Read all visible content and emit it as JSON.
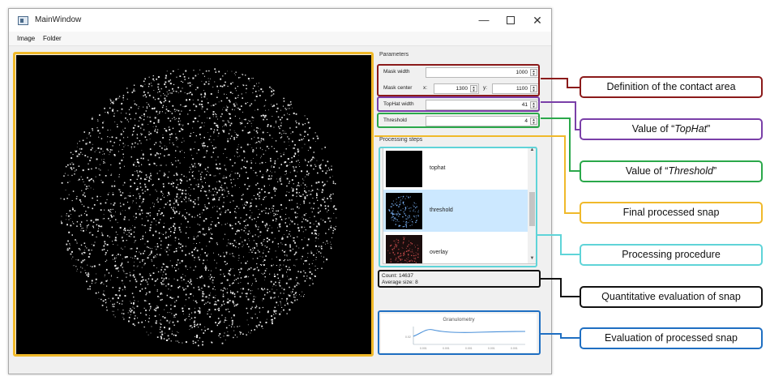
{
  "window": {
    "title": "MainWindow",
    "min": "—",
    "close": "✕"
  },
  "menu": {
    "image": "Image",
    "folder": "Folder"
  },
  "parameters": {
    "group_title": "Parameters",
    "mask_width_label": "Mask width",
    "mask_width": "1000",
    "mask_center_label": "Mask center",
    "x_label": "x:",
    "mask_center_x": "1300",
    "y_label": "y:",
    "mask_center_y": "1100",
    "tophat_label": "TopHat width",
    "tophat": "41",
    "threshold_label": "Threshold",
    "threshold": "4"
  },
  "processing": {
    "group_title": "Processing steps",
    "items": [
      {
        "label": "tophat",
        "selected": false
      },
      {
        "label": "threshold",
        "selected": true
      },
      {
        "label": "overlay",
        "selected": false
      }
    ]
  },
  "stats": {
    "count": "Count: 14637",
    "avg": "Average size: 8"
  },
  "granulometry": {
    "title": "Granulometry"
  },
  "callouts": {
    "contact": "Definition of the contact area",
    "tophat_pre": "Value of “",
    "tophat_em": "TopHat",
    "tophat_post": "”",
    "threshold_pre": "Value of “",
    "threshold_em": "Threshold",
    "threshold_post": "”",
    "final": "Final processed snap",
    "procedure": "Processing procedure",
    "quant": "Quantitative evaluation of snap",
    "eval": "Evaluation of processed snap"
  },
  "colors": {
    "contact": "#8b1a1a",
    "tophat": "#7a3fa8",
    "threshold": "#2aa84a",
    "final": "#f0b92a",
    "procedure": "#5fd4d8",
    "quant": "#111111",
    "eval": "#1f6fc2",
    "selection": "#cce8ff"
  }
}
